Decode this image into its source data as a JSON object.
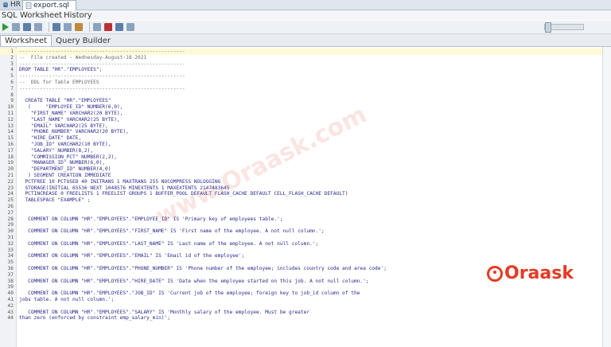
{
  "tabs": [
    {
      "label": "HR"
    },
    {
      "label": "export.sql"
    }
  ],
  "subtabs": [
    "SQL Worksheet",
    "History"
  ],
  "worksheet_tabs": [
    "Worksheet",
    "Query Builder"
  ],
  "watermark": "www.Oraask.com",
  "logo": "Oraask",
  "colors": {
    "accent": "#e53a24",
    "run": "#2e9a3a",
    "keyword": "#2331a8"
  },
  "lines": [
    {
      "n": "1",
      "t": "--------------------------------------------------------"
    },
    {
      "n": "2",
      "t": "--  File created - Wednesday-August-18-2021"
    },
    {
      "n": "3",
      "t": "--------------------------------------------------------"
    },
    {
      "n": "4",
      "t": "DROP TABLE \"HR\".\"EMPLOYEES\";"
    },
    {
      "n": "5",
      "t": "--------------------------------------------------------"
    },
    {
      "n": "6",
      "t": "--  DDL for Table EMPLOYEES"
    },
    {
      "n": "7",
      "t": "--------------------------------------------------------"
    },
    {
      "n": "8",
      "t": ""
    },
    {
      "n": "9",
      "t": "  CREATE TABLE \"HR\".\"EMPLOYEES\""
    },
    {
      "n": "10",
      "t": "   (     \"EMPLOYEE_ID\" NUMBER(6,0),"
    },
    {
      "n": "11",
      "t": "    \"FIRST_NAME\" VARCHAR2(20 BYTE),"
    },
    {
      "n": "12",
      "t": "    \"LAST_NAME\" VARCHAR2(25 BYTE),"
    },
    {
      "n": "13",
      "t": "    \"EMAIL\" VARCHAR2(25 BYTE),"
    },
    {
      "n": "14",
      "t": "    \"PHONE_NUMBER\" VARCHAR2(20 BYTE),"
    },
    {
      "n": "15",
      "t": "    \"HIRE_DATE\" DATE,"
    },
    {
      "n": "16",
      "t": "    \"JOB_ID\" VARCHAR2(10 BYTE),"
    },
    {
      "n": "17",
      "t": "    \"SALARY\" NUMBER(8,2),"
    },
    {
      "n": "18",
      "t": "    \"COMMISSION_PCT\" NUMBER(2,2),"
    },
    {
      "n": "19",
      "t": "    \"MANAGER_ID\" NUMBER(6,0),"
    },
    {
      "n": "20",
      "t": "    \"DEPARTMENT_ID\" NUMBER(4,0)"
    },
    {
      "n": "21",
      "t": "   ) SEGMENT CREATION IMMEDIATE"
    },
    {
      "n": "22",
      "t": "  PCTFREE 10 PCTUSED 40 INITRANS 1 MAXTRANS 255 NOCOMPRESS NOLOGGING"
    },
    {
      "n": "23",
      "t": "  STORAGE(INITIAL 65536 NEXT 1048576 MINEXTENTS 1 MAXEXTENTS 2147483645"
    },
    {
      "n": "24",
      "t": "  PCTINCREASE 0 FREELISTS 1 FREELIST GROUPS 1 BUFFER_POOL DEFAULT FLASH_CACHE DEFAULT CELL_FLASH_CACHE DEFAULT)"
    },
    {
      "n": "25",
      "t": "  TABLESPACE \"EXAMPLE\" ;"
    },
    {
      "n": "26",
      "t": ""
    },
    {
      "n": "27",
      "t": ""
    },
    {
      "n": "28",
      "t": "   COMMENT ON COLUMN \"HR\".\"EMPLOYEES\".\"EMPLOYEE_ID\" IS 'Primary key of employees table.';"
    },
    {
      "n": "29",
      "t": ""
    },
    {
      "n": "30",
      "t": "   COMMENT ON COLUMN \"HR\".\"EMPLOYEES\".\"FIRST_NAME\" IS 'First name of the employee. A not null column.';"
    },
    {
      "n": "31",
      "t": ""
    },
    {
      "n": "32",
      "t": "   COMMENT ON COLUMN \"HR\".\"EMPLOYEES\".\"LAST_NAME\" IS 'Last name of the employee. A not null column.';"
    },
    {
      "n": "33",
      "t": ""
    },
    {
      "n": "34",
      "t": "   COMMENT ON COLUMN \"HR\".\"EMPLOYEES\".\"EMAIL\" IS 'Email id of the employee';"
    },
    {
      "n": "35",
      "t": ""
    },
    {
      "n": "36",
      "t": "   COMMENT ON COLUMN \"HR\".\"EMPLOYEES\".\"PHONE_NUMBER\" IS 'Phone number of the employee; includes country code and area code';"
    },
    {
      "n": "37",
      "t": ""
    },
    {
      "n": "38",
      "t": "   COMMENT ON COLUMN \"HR\".\"EMPLOYEES\".\"HIRE_DATE\" IS 'Date when the employee started on this job. A not null column.';"
    },
    {
      "n": "39",
      "t": ""
    },
    {
      "n": "40",
      "t": "   COMMENT ON COLUMN \"HR\".\"EMPLOYEES\".\"JOB_ID\" IS 'Current job of the employee; foreign key to job_id column of the"
    },
    {
      "n": "41",
      "t": "jobs table. A not null column.';"
    },
    {
      "n": "42",
      "t": ""
    },
    {
      "n": "43",
      "t": "   COMMENT ON COLUMN \"HR\".\"EMPLOYEES\".\"SALARY\" IS 'Monthly salary of the employee. Must be greater"
    },
    {
      "n": "44",
      "t": "than zero (enforced by constraint emp_salary_min)';"
    }
  ]
}
